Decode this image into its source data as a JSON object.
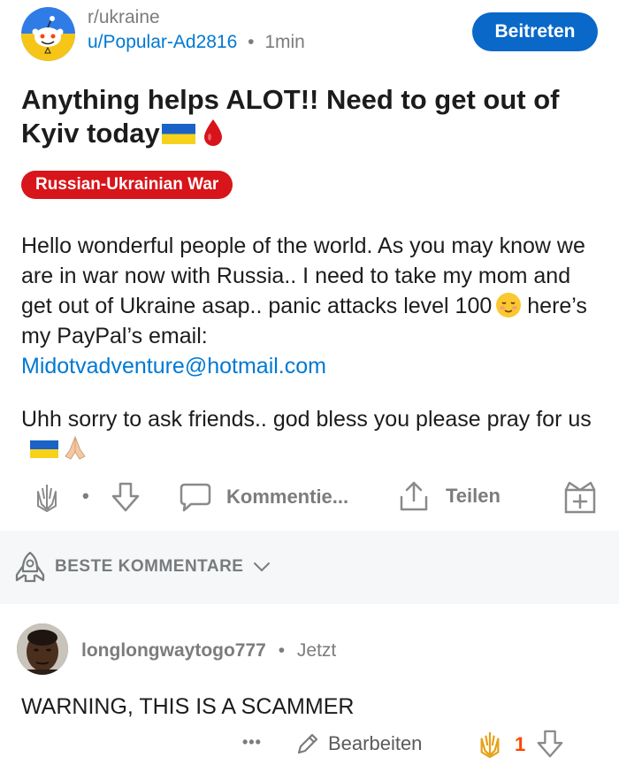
{
  "post": {
    "subreddit": "r/ukraine",
    "username": "u/Popular-Ad2816",
    "separator": "•",
    "time": "1min",
    "join_label": "Beitreten",
    "title": "Anything helps ALOT!! Need to get out of Kyiv today",
    "flair": "Russian-Ukrainian War",
    "flair_color": "#d7151a",
    "body_p1_a": "Hello wonderful people of the world. As you may know we are in war now with Russia.. I need to take my mom and get out of Ukraine asap.. panic attacks level 100",
    "body_p1_b": "here’s my PayPal’s email:",
    "email": "Midotvadventure@hotmail.com",
    "body_p2": "Uhh sorry to ask friends.. god bless you please pray for us",
    "vote_dot": "•",
    "comments_label": "Kommentie...",
    "share_label": "Teilen"
  },
  "sort": {
    "label": "BESTE KOMMENTARE"
  },
  "comment": {
    "username": "longlongwaytogo777",
    "separator": "•",
    "time": "Jetzt",
    "text": "WARNING, THIS IS A SCAMMER",
    "more_label": "•••",
    "edit_label": "Bearbeiten",
    "score": "1"
  },
  "colors": {
    "accent": "#0079d3",
    "join_button": "#0a68c8",
    "upvote_gold": "#e7a21a",
    "score_orange": "#ff4500",
    "meta_gray": "#7c7c7c"
  }
}
